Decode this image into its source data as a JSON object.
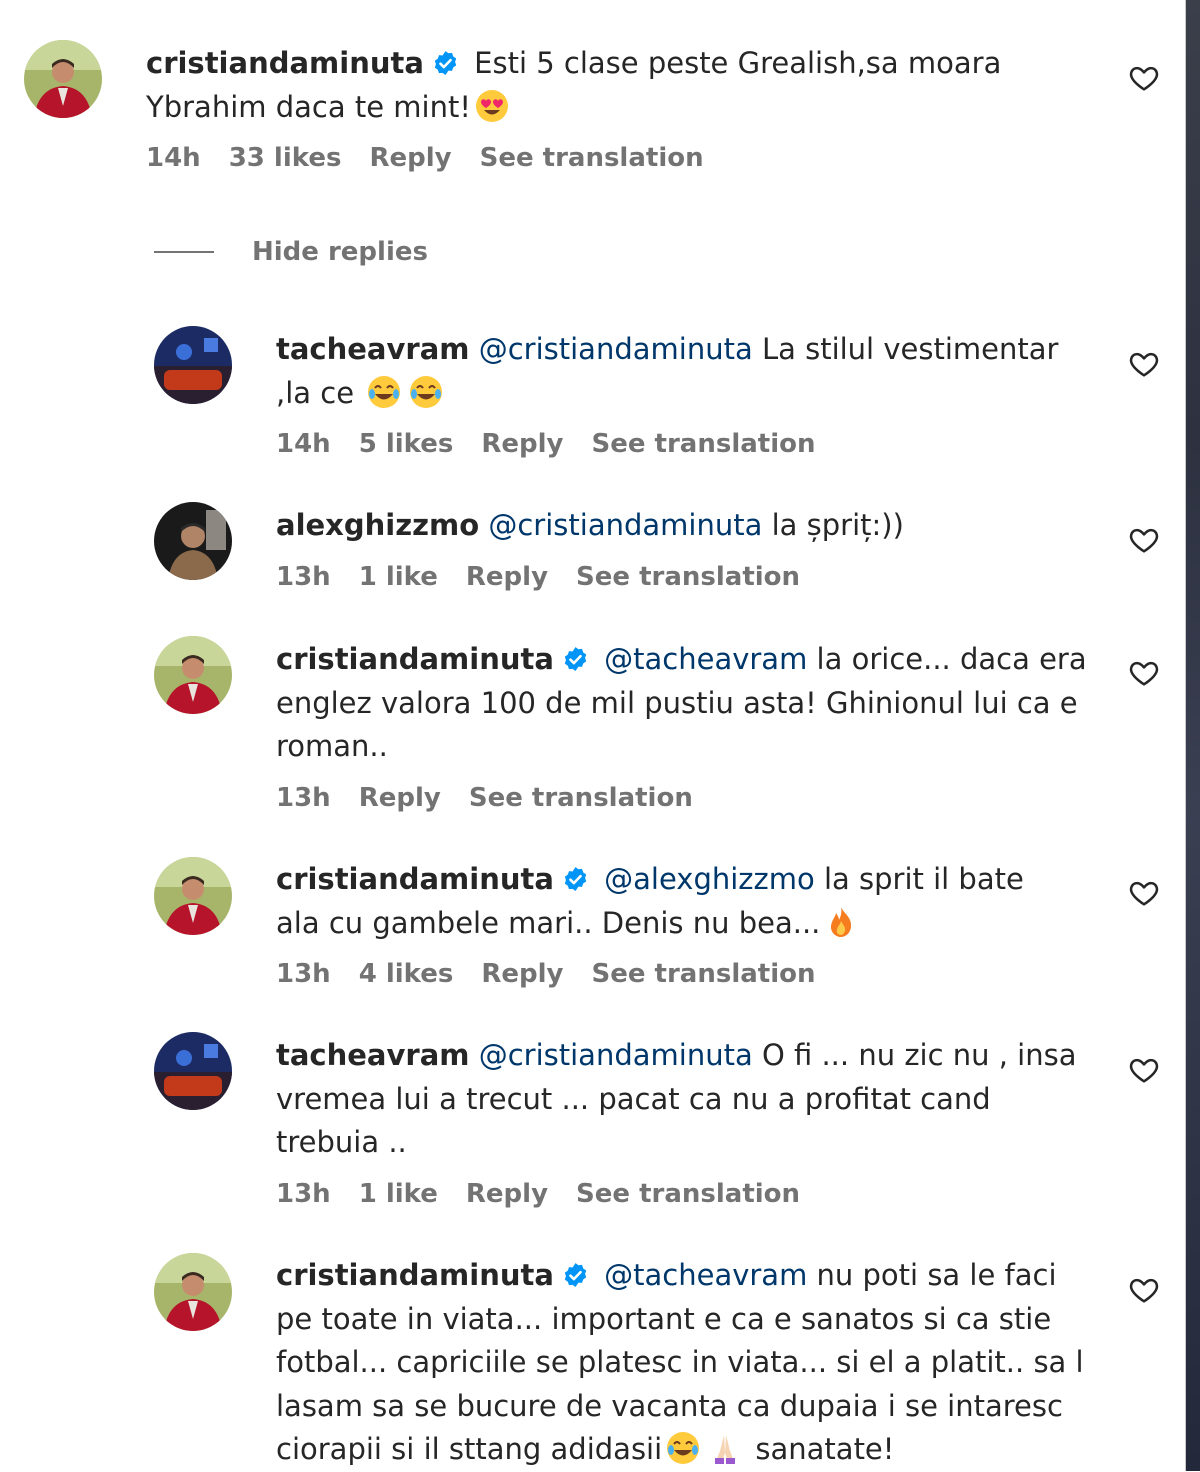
{
  "top_comment": {
    "username": "cristiandaminuta",
    "verified": true,
    "text": "Esti 5 clase peste Grealish,sa moara Ybrahim daca te mint!",
    "emoji": "heart-eyes-emoji",
    "time": "14h",
    "likes": "33 likes",
    "reply_label": "Reply",
    "translate_label": "See translation"
  },
  "hide_replies_label": "Hide replies",
  "replies": [
    {
      "username": "tacheavram",
      "verified": false,
      "mention": "@cristiandaminuta",
      "text_a": "La stilul vestimentar ,la ce",
      "time": "14h",
      "likes": "5 likes",
      "reply_label": "Reply",
      "translate_label": "See translation"
    },
    {
      "username": "alexghizzmo",
      "verified": false,
      "mention": "@cristiandaminuta",
      "text_a": "la șpriț:))",
      "time": "13h",
      "likes": "1 like",
      "reply_label": "Reply",
      "translate_label": "See translation"
    },
    {
      "username": "cristiandaminuta",
      "verified": true,
      "mention": "@tacheavram",
      "text_a": "la orice... daca era englez valora 100 de mil pustiu asta! Ghinionul lui ca e roman..",
      "time": "13h",
      "reply_label": "Reply",
      "translate_label": "See translation"
    },
    {
      "username": "cristiandaminuta",
      "verified": true,
      "mention": "@alexghizzmo",
      "text_a": "la sprit il bate ala cu gambele mari.. Denis nu bea...",
      "time": "13h",
      "likes": "4 likes",
      "reply_label": "Reply",
      "translate_label": "See translation"
    },
    {
      "username": "tacheavram",
      "verified": false,
      "mention": "@cristiandaminuta",
      "text_a": "O fi ... nu zic nu , insa vremea lui a trecut ... pacat ca nu a profitat cand trebuia ..",
      "time": "13h",
      "likes": "1 like",
      "reply_label": "Reply",
      "translate_label": "See translation"
    },
    {
      "username": "cristiandaminuta",
      "verified": true,
      "mention": "@tacheavram",
      "text_a": "nu poti sa le faci pe toate in viata... important e ca e sanatos si ca stie fotbal... capriciile se platesc in viata... si el a platit.. sa l lasam sa se bucure de vacanta ca dupaia i se intaresc ciorapii si il sttang adidasii",
      "text_b": "sanatate!"
    }
  ],
  "colors": {
    "text": "#262626",
    "meta": "#737373",
    "mention": "#00376b",
    "verified": "#0095f6"
  }
}
